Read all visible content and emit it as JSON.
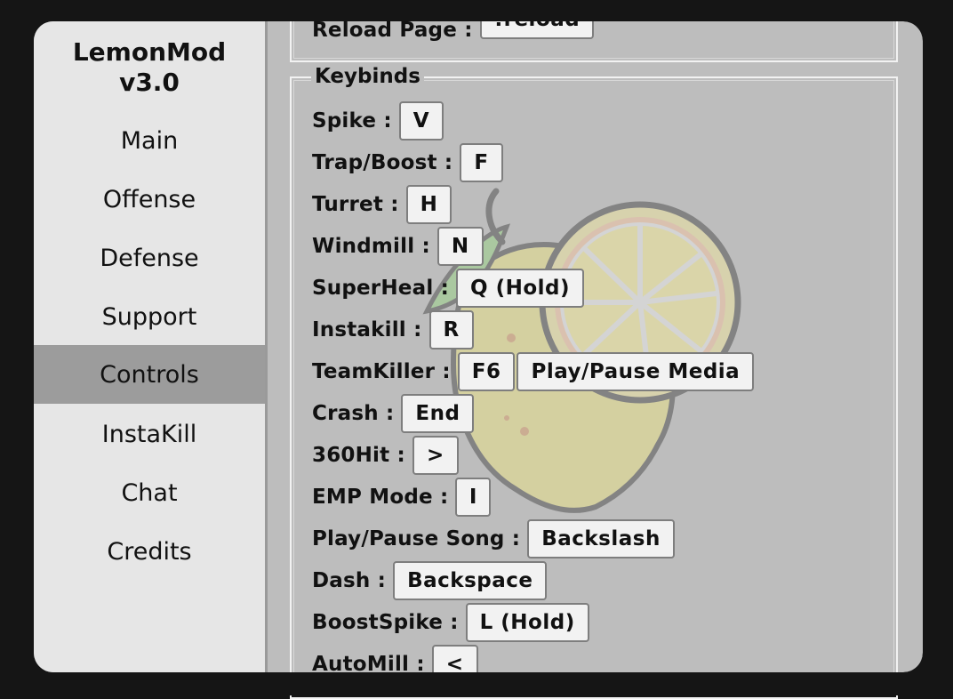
{
  "app": {
    "title": "LemonMod v3.0"
  },
  "sidebar": {
    "items": [
      {
        "label": "Main"
      },
      {
        "label": "Offense"
      },
      {
        "label": "Defense"
      },
      {
        "label": "Support"
      },
      {
        "label": "Controls",
        "active": true
      },
      {
        "label": "InstaKill"
      },
      {
        "label": "Chat"
      },
      {
        "label": "Credits"
      }
    ]
  },
  "reload": {
    "label": "Reload Page :",
    "key": "!reload"
  },
  "keybinds": {
    "legend": "Keybinds",
    "rows": [
      {
        "label": "Spike :",
        "keys": [
          "V"
        ]
      },
      {
        "label": "Trap/Boost :",
        "keys": [
          "F"
        ]
      },
      {
        "label": "Turret :",
        "keys": [
          "H"
        ]
      },
      {
        "label": "Windmill :",
        "keys": [
          "N"
        ]
      },
      {
        "label": "SuperHeal :",
        "keys": [
          "Q (Hold)"
        ]
      },
      {
        "label": "Instakill :",
        "keys": [
          "R"
        ]
      },
      {
        "label": "TeamKiller :",
        "keys": [
          "F6",
          "Play/Pause Media"
        ]
      },
      {
        "label": "Crash :",
        "keys": [
          "End"
        ]
      },
      {
        "label": "360Hit :",
        "keys": [
          ">"
        ]
      },
      {
        "label": "EMP Mode :",
        "keys": [
          "I"
        ]
      },
      {
        "label": "Play/Pause Song :",
        "keys": [
          "Backslash"
        ]
      },
      {
        "label": "Dash :",
        "keys": [
          "Backspace"
        ]
      },
      {
        "label": "BoostSpike :",
        "keys": [
          "L (Hold)"
        ]
      },
      {
        "label": "AutoMill :",
        "keys": [
          "<"
        ]
      }
    ]
  },
  "colors": {
    "window_bg": "#bdbdbd",
    "sidebar_bg": "#e6e6e6",
    "active_bg": "#9c9c9c",
    "key_bg": "#f2f2f2"
  },
  "icons": {
    "background": "lemon-illustration"
  }
}
